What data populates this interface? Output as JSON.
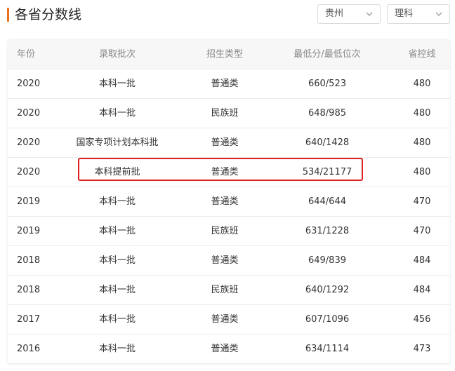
{
  "header": {
    "title": "各省分数线",
    "accent_color": "#e8731a",
    "province_select": {
      "value": "贵州",
      "icon": "chevron-down-icon"
    },
    "subject_select": {
      "value": "理科",
      "icon": "chevron-down-icon"
    }
  },
  "table": {
    "columns": [
      "年份",
      "录取批次",
      "招生类型",
      "最低分/最低位次",
      "省控线"
    ],
    "rows": [
      {
        "year": "2020",
        "batch": "本科一批",
        "type": "普通类",
        "score": "660/523",
        "line": "480"
      },
      {
        "year": "2020",
        "batch": "本科一批",
        "type": "民族班",
        "score": "648/985",
        "line": "480"
      },
      {
        "year": "2020",
        "batch": "国家专项计划本科批",
        "type": "普通类",
        "score": "640/1428",
        "line": "480"
      },
      {
        "year": "2020",
        "batch": "本科提前批",
        "type": "普通类",
        "score": "534/21177",
        "line": "480"
      },
      {
        "year": "2019",
        "batch": "本科一批",
        "type": "普通类",
        "score": "644/644",
        "line": "470"
      },
      {
        "year": "2019",
        "batch": "本科一批",
        "type": "民族班",
        "score": "631/1228",
        "line": "470"
      },
      {
        "year": "2018",
        "batch": "本科一批",
        "type": "普通类",
        "score": "649/839",
        "line": "484"
      },
      {
        "year": "2018",
        "batch": "本科一批",
        "type": "民族班",
        "score": "640/1292",
        "line": "484"
      },
      {
        "year": "2017",
        "batch": "本科一批",
        "type": "普通类",
        "score": "607/1096",
        "line": "456"
      },
      {
        "year": "2016",
        "batch": "本科一批",
        "type": "普通类",
        "score": "634/1114",
        "line": "473"
      }
    ],
    "highlight_color": "#e02020"
  }
}
